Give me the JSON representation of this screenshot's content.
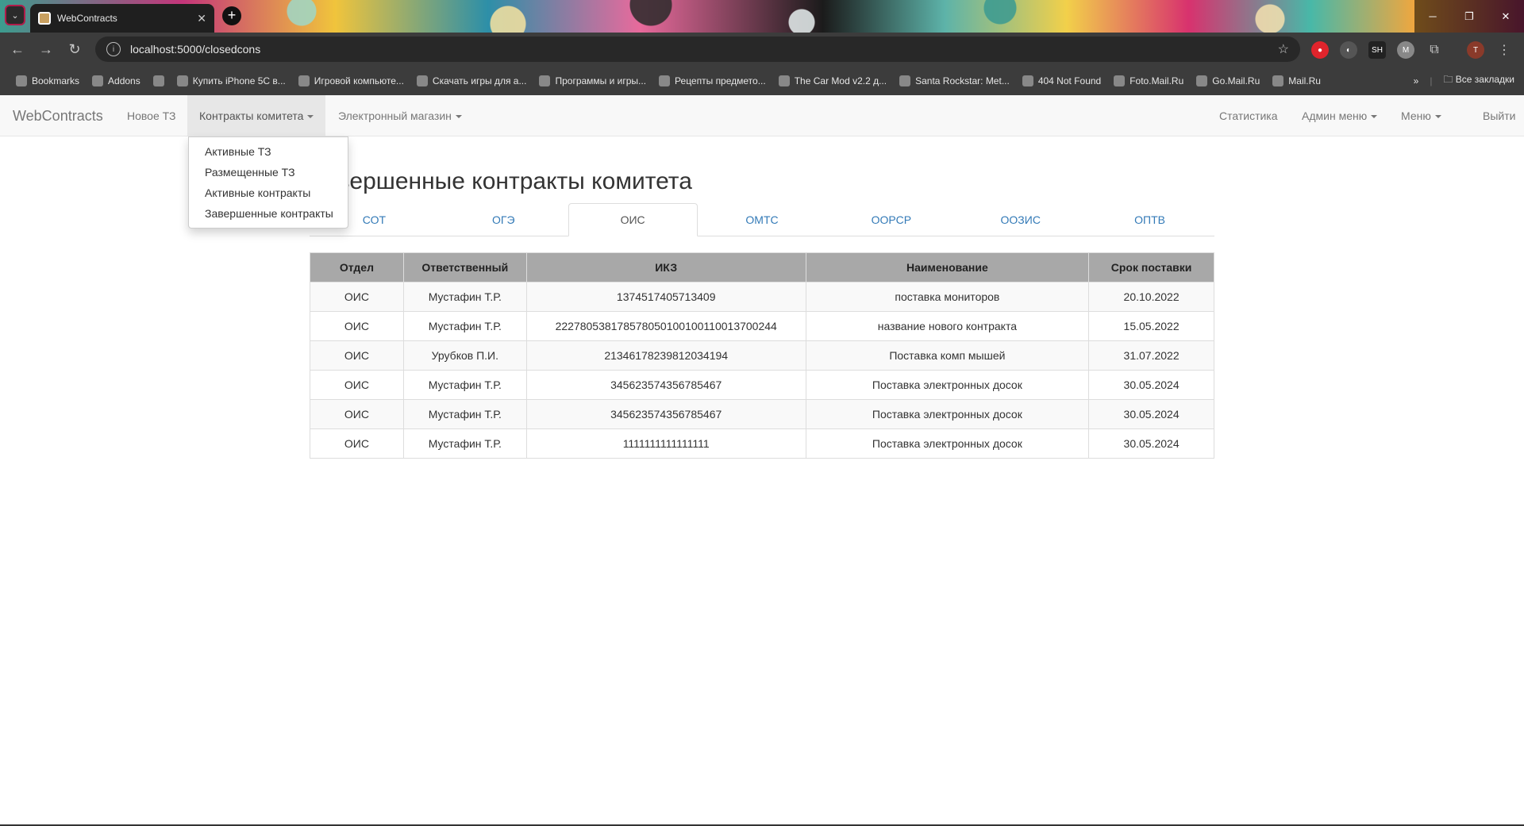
{
  "browser": {
    "tab_title": "WebContracts",
    "url": "localhost:5000/closedcons",
    "bookmarks": [
      {
        "label": "Bookmarks",
        "icon": "star-icon"
      },
      {
        "label": "Addons",
        "icon": "addons-icon"
      },
      {
        "label": "",
        "icon": "folder-icon"
      },
      {
        "label": "Купить iPhone 5С в...",
        "icon": "shop-icon"
      },
      {
        "label": "Игровой компьюте...",
        "icon": "globe-icon"
      },
      {
        "label": "Скачать игры для а...",
        "icon": "android-icon"
      },
      {
        "label": "Программы и игры...",
        "icon": "image-icon"
      },
      {
        "label": "Рецепты предмето...",
        "icon": "recipe-icon"
      },
      {
        "label": "The Car Mod v2.2 д...",
        "icon": "globe-icon"
      },
      {
        "label": "Santa Rockstar: Met...",
        "icon": "cn-icon"
      },
      {
        "label": "404 Not Found",
        "icon": "globe-icon"
      },
      {
        "label": "Foto.Mail.Ru",
        "icon": "mail-icon"
      },
      {
        "label": "Go.Mail.Ru",
        "icon": "mail-icon"
      },
      {
        "label": "Mail.Ru",
        "icon": "mail-icon"
      }
    ],
    "all_bookmarks": "Все закладки",
    "profile_initial": "T"
  },
  "app": {
    "brand": "WebContracts",
    "nav": {
      "new_tz": "Новое ТЗ",
      "committee_contracts": "Контракты комитета",
      "eshop": "Электронный магазин",
      "stats": "Статистика",
      "admin_menu": "Админ меню",
      "menu": "Меню",
      "logout": "Выйти"
    },
    "dropdown": [
      "Активные ТЗ",
      "Размещенные ТЗ",
      "Активные контракты",
      "Завершенные контракты"
    ],
    "page_title": "Завершенные контракты комитета",
    "tabs": [
      "СОТ",
      "ОГЭ",
      "ОИС",
      "ОМТС",
      "ООРСР",
      "ООЗИС",
      "ОПТВ"
    ],
    "active_tab": "ОИС",
    "table": {
      "headers": [
        "Отдел",
        "Ответственный",
        "ИКЗ",
        "Наименование",
        "Срок поставки"
      ],
      "rows": [
        [
          "ОИС",
          "Мустафин Т.Р.",
          "1374517405713409",
          "поставка мониторов",
          "20.10.2022"
        ],
        [
          "ОИС",
          "Мустафин Т.Р.",
          "222780538178578050100100110013700244",
          "название нового контракта",
          "15.05.2022"
        ],
        [
          "ОИС",
          "Урубков П.И.",
          "21346178239812034194",
          "Поставка комп мышей",
          "31.07.2022"
        ],
        [
          "ОИС",
          "Мустафин Т.Р.",
          "345623574356785467",
          "Поставка электронных досок",
          "30.05.2024"
        ],
        [
          "ОИС",
          "Мустафин Т.Р.",
          "345623574356785467",
          "Поставка электронных досок",
          "30.05.2024"
        ],
        [
          "ОИС",
          "Мустафин Т.Р.",
          "1111111111111111",
          "Поставка электронных досок",
          "30.05.2024"
        ]
      ]
    }
  }
}
